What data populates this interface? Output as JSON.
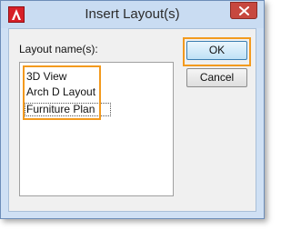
{
  "window": {
    "title": "Insert Layout(s)"
  },
  "icons": {
    "app": "autocad-logo-icon",
    "close": "close-icon"
  },
  "dialog": {
    "label": "Layout name(s):",
    "items": [
      "3D View",
      "Arch D Layout",
      "Furniture Plan"
    ],
    "selected_item": "Furniture Plan",
    "ok_label": "OK",
    "cancel_label": "Cancel"
  },
  "colors": {
    "highlight": "#f39a1e",
    "close_button": "#c7483f",
    "app_icon": "#d72028"
  }
}
